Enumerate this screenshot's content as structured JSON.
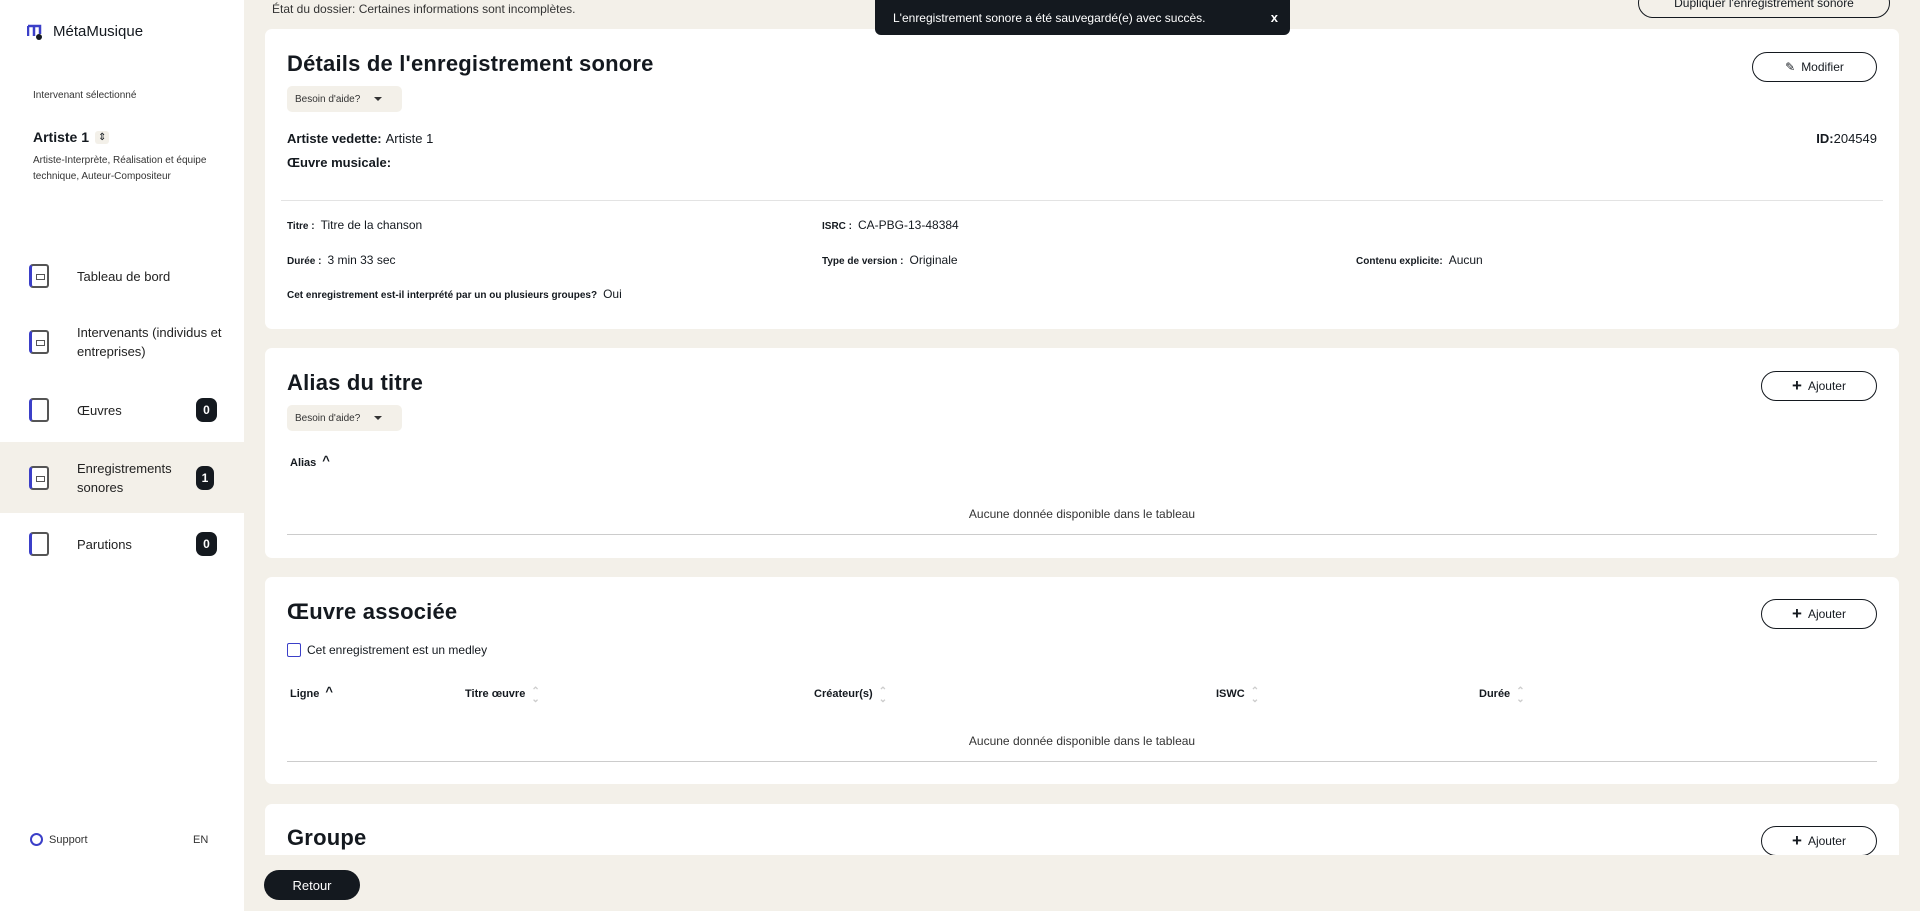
{
  "app": {
    "name": "MétaMusique"
  },
  "sidebar": {
    "selected_label": "Intervenant sélectionné",
    "selected_name": "Artiste 1",
    "selected_roles": "Artiste-Interprète, Réalisation et équipe technique, Auteur-Compositeur",
    "items": [
      {
        "label": "Tableau de bord",
        "icon": "dashboard-icon"
      },
      {
        "label": "Intervenants (individus et entreprises)",
        "icon": "contributors-icon"
      },
      {
        "label": "Œuvres",
        "icon": "works-icon",
        "count": "0"
      },
      {
        "label": "Enregistrements sonores",
        "icon": "recordings-icon",
        "count": "1",
        "active": true
      },
      {
        "label": "Parutions",
        "icon": "releases-icon",
        "count": "0"
      }
    ],
    "support": "Support",
    "language": "EN"
  },
  "header": {
    "status": "État du dossier: Certaines informations sont incomplètes.",
    "duplicate": "Dupliquer l'enregistrement sonore"
  },
  "toast": {
    "message": "L'enregistrement sonore a été sauvegardé(e) avec succès.",
    "close": "x"
  },
  "details": {
    "title": "Détails de l'enregistrement sonore",
    "help": "Besoin d'aide?",
    "edit": "Modifier",
    "featured_label": "Artiste vedette:",
    "featured_value": "Artiste 1",
    "work_label": "Œuvre musicale:",
    "id_label": "ID:",
    "id_value": "204549",
    "title_label": "Titre :",
    "title_value": "Titre de la chanson",
    "isrc_label": "ISRC :",
    "isrc_value": "CA-PBG-13-48384",
    "duration_label": "Durée :",
    "duration_value": "3 min 33 sec",
    "version_label": "Type de version :",
    "version_value": "Originale",
    "explicit_label": "Contenu explicite:",
    "explicit_value": "Aucun",
    "group_q_label": "Cet enregistrement est-il interprété par un ou plusieurs groupes?",
    "group_q_value": "Oui"
  },
  "alias": {
    "title": "Alias du titre",
    "help": "Besoin d'aide?",
    "add": "Ajouter",
    "col": "Alias",
    "empty": "Aucune donnée disponible dans le tableau"
  },
  "work": {
    "title": "Œuvre associée",
    "add": "Ajouter",
    "medley": "Cet enregistrement est un medley",
    "cols": [
      "Ligne",
      "Titre œuvre",
      "Créateur(s)",
      "ISWC",
      "Durée"
    ],
    "empty": "Aucune donnée disponible dans le tableau"
  },
  "group": {
    "title": "Groupe",
    "add": "Ajouter"
  },
  "footer": {
    "back": "Retour"
  }
}
